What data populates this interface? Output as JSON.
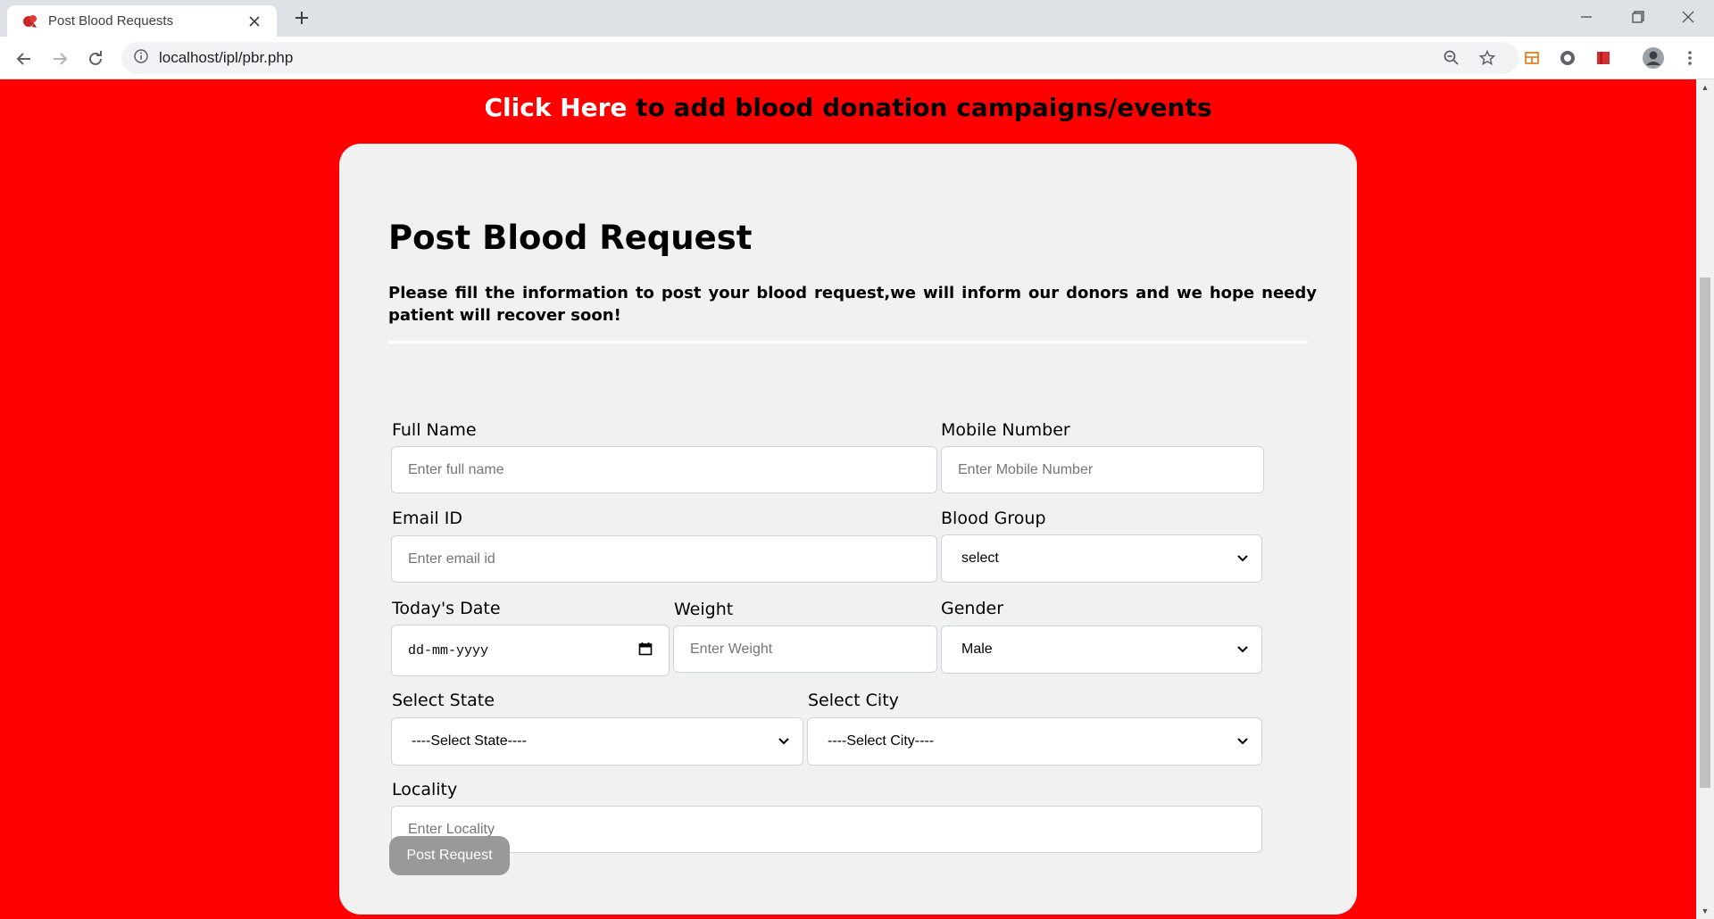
{
  "browser": {
    "tab_title": "Post Blood Requests",
    "url": "localhost/ipl/pbr.php",
    "icons": [
      "favicon-icon",
      "close-icon",
      "plus-icon",
      "minimize-icon",
      "restore-icon",
      "close-window-icon",
      "back-icon",
      "forward-icon",
      "reload-icon",
      "info-icon",
      "zoom-icon",
      "star-icon",
      "extension-icon",
      "profile-icon",
      "menu-icon"
    ]
  },
  "banner": {
    "link_text": "Click Here",
    "rest_text": " to add blood donation campaigns/events"
  },
  "form": {
    "title": "Post Blood Request",
    "description": "Please fill the information to post your blood request,we will inform our donors and we hope needy patient will recover soon!",
    "full_name": {
      "label": "Full Name",
      "placeholder": "Enter full name"
    },
    "mobile": {
      "label": "Mobile Number",
      "placeholder": "Enter Mobile Number"
    },
    "email": {
      "label": "Email ID",
      "placeholder": "Enter email id"
    },
    "blood_group": {
      "label": "Blood Group",
      "value": "select"
    },
    "date": {
      "label": "Today's Date",
      "value": "dd-mm-yyyy"
    },
    "weight": {
      "label": "Weight",
      "placeholder": "Enter Weight"
    },
    "gender": {
      "label": "Gender",
      "value": "Male"
    },
    "state": {
      "label": "Select State",
      "value": "----Select State----"
    },
    "city": {
      "label": "Select City",
      "value": "----Select City----"
    },
    "locality": {
      "label": "Locality",
      "placeholder": "Enter Locality"
    },
    "submit_label": "Post Request"
  },
  "colors": {
    "page_bg": "#ff0000",
    "card_bg": "#f1f1f1",
    "button_bg": "#999999"
  }
}
